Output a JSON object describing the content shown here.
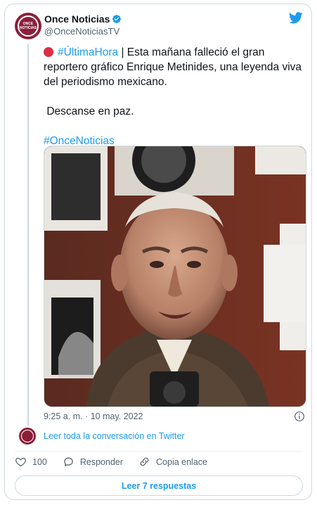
{
  "account": {
    "display_name": "Once Noticias",
    "handle": "@OnceNoticiasTV",
    "avatar_text": "ONCE NOTICIAS"
  },
  "tweet": {
    "line1_hashtag": "#ÚltimaHora",
    "body": " | Esta mañana falleció el gran reportero gráfico Enrique Metinides, una leyenda viva del periodismo mexicano.",
    "line2": "Descanse en paz.",
    "closing_hashtag": "#OnceNoticias",
    "timestamp": "9:25 a. m. · 10 may. 2022"
  },
  "thread": {
    "link_label": "Leer toda la conversación en Twitter"
  },
  "actions": {
    "like_count": "100",
    "reply_label": "Responder",
    "copy_label": "Copia enlace"
  },
  "footer": {
    "read_replies_label": "Leer 7 respuestas"
  },
  "icons": {
    "verified": "verified-badge-icon",
    "twitter": "twitter-bird-icon",
    "info": "info-icon",
    "like": "heart-icon",
    "reply": "speech-bubble-icon",
    "copy": "link-icon"
  },
  "colors": {
    "link": "#1d9bf0",
    "brand": "#8b1f3a",
    "muted": "#536471",
    "border": "#cfd9de"
  }
}
